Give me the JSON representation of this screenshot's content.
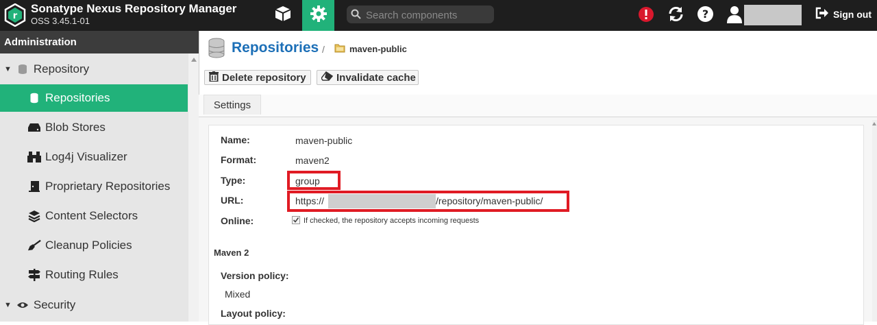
{
  "header": {
    "app_title": "Sonatype Nexus Repository Manager",
    "version": "OSS 3.45.1-01",
    "search_placeholder": "Search components",
    "sign_out_label": "Sign out"
  },
  "sidebar": {
    "section_title": "Administration",
    "groups": [
      {
        "label": "Repository",
        "items": [
          {
            "label": "Repositories",
            "icon": "database-icon",
            "active": true
          },
          {
            "label": "Blob Stores",
            "icon": "hard-drive-icon"
          },
          {
            "label": "Log4j Visualizer",
            "icon": "binoculars-icon"
          },
          {
            "label": "Proprietary Repositories",
            "icon": "door-icon"
          },
          {
            "label": "Content Selectors",
            "icon": "layers-icon"
          },
          {
            "label": "Cleanup Policies",
            "icon": "broom-icon"
          },
          {
            "label": "Routing Rules",
            "icon": "signpost-icon"
          }
        ]
      },
      {
        "label": "Security",
        "items": []
      }
    ]
  },
  "main": {
    "page_title": "Repositories",
    "breadcrumb_current": "maven-public",
    "breadcrumb_separator": "/",
    "toolbar": {
      "delete_label": "Delete repository",
      "invalidate_label": "Invalidate cache"
    },
    "tabs": [
      "Settings"
    ],
    "fields": {
      "name_label": "Name:",
      "name_value": "maven-public",
      "format_label": "Format:",
      "format_value": "maven2",
      "type_label": "Type:",
      "type_value": "group",
      "url_label": "URL:",
      "url_prefix": "https://",
      "url_suffix": "/repository/maven-public/",
      "online_label": "Online:",
      "online_text": "If checked, the repository accepts incoming requests",
      "online_checked": true
    },
    "maven_section_title": "Maven 2",
    "version_policy_label": "Version policy:",
    "version_policy_value": "Mixed",
    "layout_policy_label": "Layout policy:"
  },
  "colors": {
    "accent": "#21b27a",
    "title_blue": "#1c6fb7",
    "highlight_red": "#e01b24",
    "alert_red": "#d9182d"
  }
}
